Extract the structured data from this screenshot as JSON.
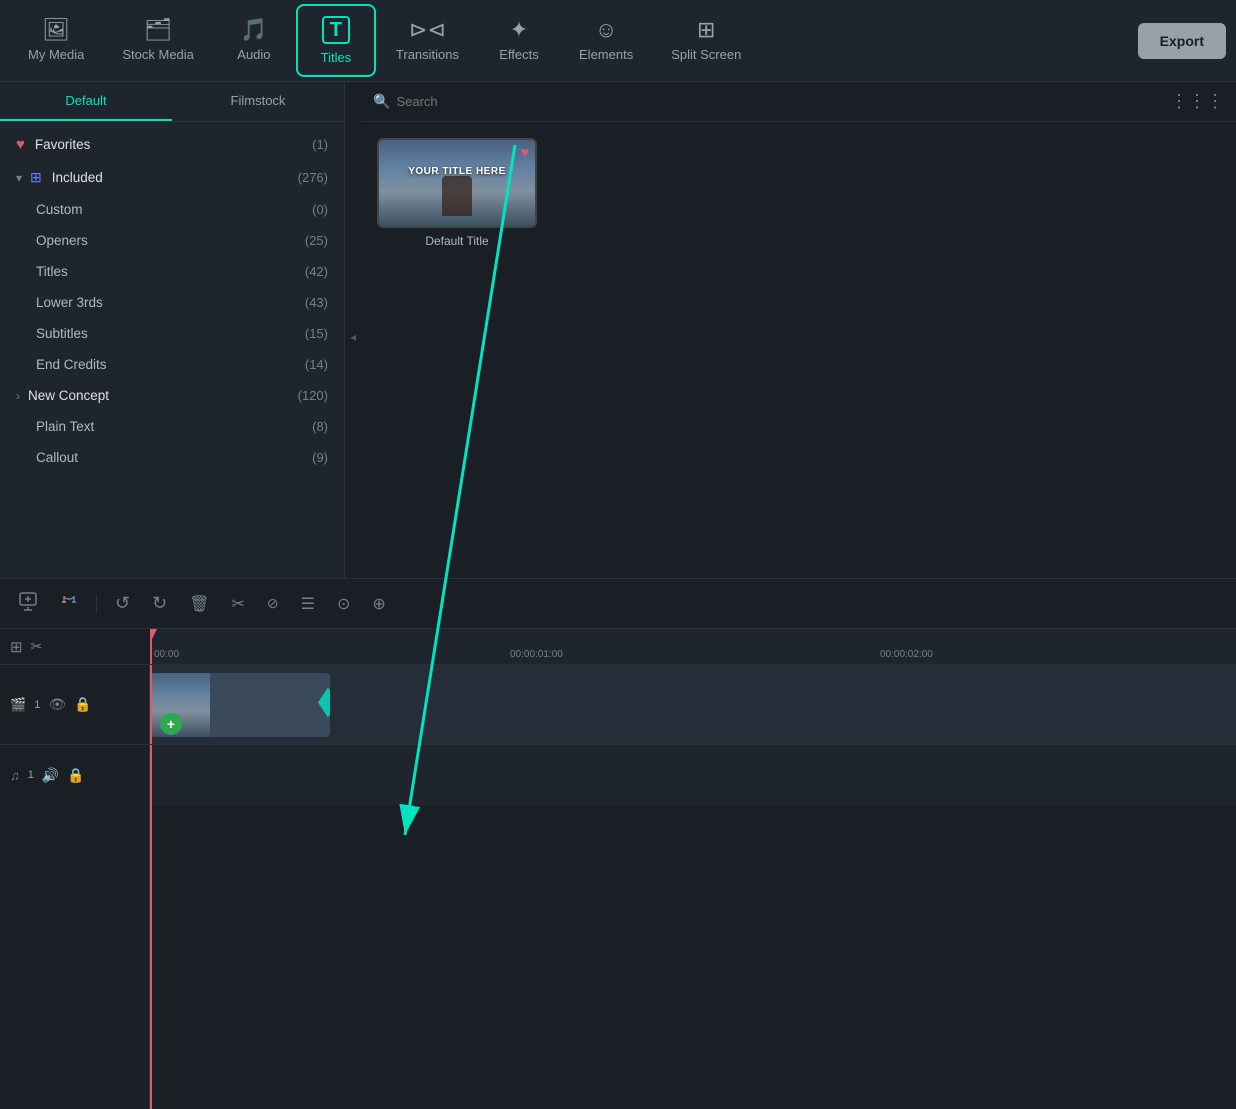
{
  "toolbar": {
    "items": [
      {
        "id": "my-media",
        "label": "My Media",
        "icon": "🖼"
      },
      {
        "id": "stock-media",
        "label": "Stock Media",
        "icon": "🗂"
      },
      {
        "id": "audio",
        "label": "Audio",
        "icon": "🎵"
      },
      {
        "id": "titles",
        "label": "Titles",
        "icon": "T",
        "active": true
      },
      {
        "id": "transitions",
        "label": "Transitions",
        "icon": "⊳⊲"
      },
      {
        "id": "effects",
        "label": "Effects",
        "icon": "✦"
      },
      {
        "id": "elements",
        "label": "Elements",
        "icon": "☺"
      },
      {
        "id": "split-screen",
        "label": "Split Screen",
        "icon": "⊞"
      }
    ],
    "export_label": "Export"
  },
  "sidebar": {
    "tabs": [
      {
        "id": "default",
        "label": "Default",
        "active": true
      },
      {
        "id": "filmstock",
        "label": "Filmstock"
      }
    ],
    "items": [
      {
        "id": "favorites",
        "type": "favorites",
        "label": "Favorites",
        "count": "(1)"
      },
      {
        "id": "included",
        "type": "section",
        "label": "Included",
        "count": "(276)",
        "expanded": true
      },
      {
        "id": "custom",
        "type": "sub",
        "label": "Custom",
        "count": "(0)"
      },
      {
        "id": "openers",
        "type": "sub",
        "label": "Openers",
        "count": "(25)"
      },
      {
        "id": "titles",
        "type": "sub",
        "label": "Titles",
        "count": "(42)"
      },
      {
        "id": "lower-3rds",
        "type": "sub",
        "label": "Lower 3rds",
        "count": "(43)"
      },
      {
        "id": "subtitles",
        "type": "sub",
        "label": "Subtitles",
        "count": "(15)"
      },
      {
        "id": "end-credits",
        "type": "sub",
        "label": "End Credits",
        "count": "(14)"
      },
      {
        "id": "new-concept",
        "type": "section-collapsed",
        "label": "New Concept",
        "count": "(120)"
      },
      {
        "id": "plain-text",
        "type": "sub",
        "label": "Plain Text",
        "count": "(8)"
      },
      {
        "id": "callout",
        "type": "sub",
        "label": "Callout",
        "count": "(9)"
      }
    ]
  },
  "search": {
    "placeholder": "Search"
  },
  "titles_grid": [
    {
      "id": "default-title",
      "label": "Default Title",
      "thumb_text": "YOUR TITLE HERE",
      "favorited": true
    }
  ],
  "timeline": {
    "toolbar_tools": [
      "undo",
      "redo",
      "delete",
      "cut",
      "unlink",
      "menu",
      "stamp",
      "forward"
    ],
    "add_label": "+",
    "link_label": "🔗",
    "timestamps": [
      "00:00",
      "00:00:01:00",
      "00:00:02:00"
    ],
    "tracks": [
      {
        "id": "video1",
        "type": "video",
        "num": "1",
        "has_clip": true
      },
      {
        "id": "audio1",
        "type": "audio",
        "num": "1"
      }
    ]
  }
}
